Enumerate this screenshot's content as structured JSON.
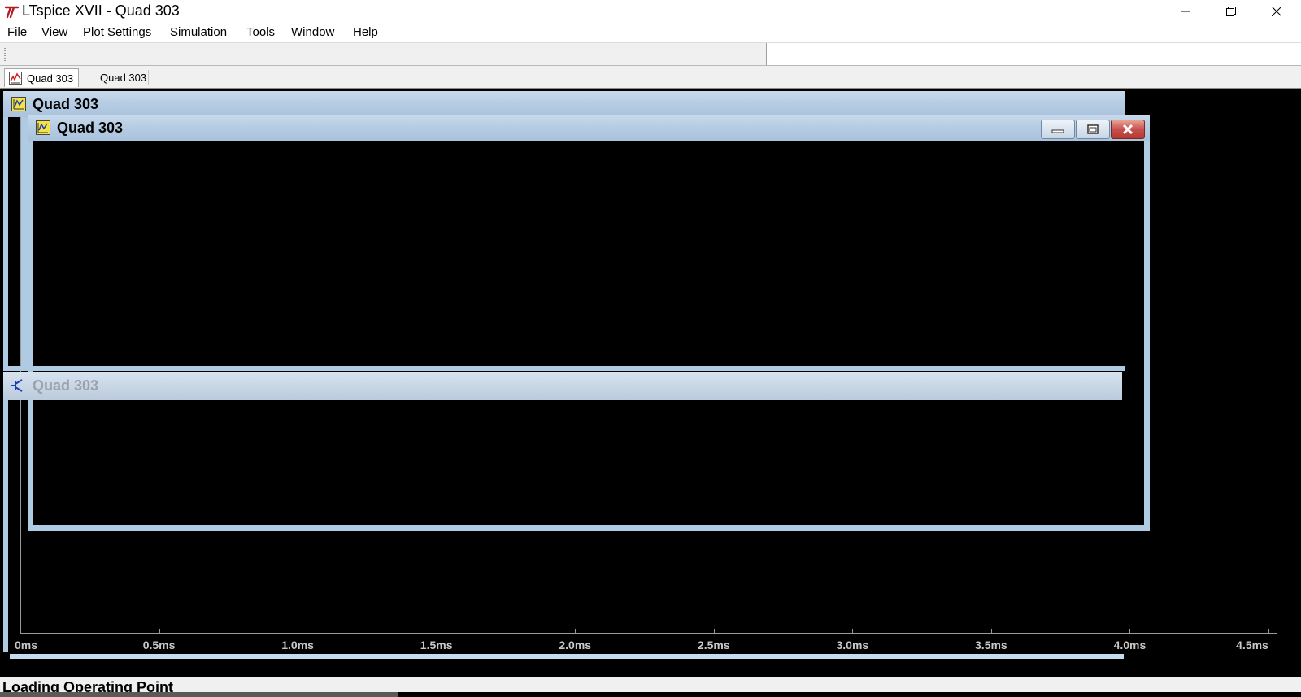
{
  "window": {
    "title": "LTspice XVII - Quad 303",
    "icon": "ltspice-logo-icon",
    "controls": [
      "minimize-icon",
      "restore-icon",
      "close-icon"
    ]
  },
  "menu": {
    "items": [
      {
        "ul": "F",
        "rest": "ile"
      },
      {
        "ul": "V",
        "rest": "iew"
      },
      {
        "ul": "P",
        "rest": "lot Settings"
      },
      {
        "ul": "S",
        "rest": "imulation"
      },
      {
        "ul": "T",
        "rest": "ools"
      },
      {
        "ul": "W",
        "rest": "indow"
      },
      {
        "ul": "H",
        "rest": "elp"
      }
    ]
  },
  "toolbar": {
    "field_value": ""
  },
  "tabs": [
    {
      "label": "Quad 303",
      "icon": "waveform-icon",
      "active": true
    },
    {
      "label": "Quad 303",
      "icon": "",
      "active": false
    }
  ],
  "child_windows": {
    "back_plot": {
      "title": "Quad 303",
      "icon": "plot-window-icon"
    },
    "front_plot": {
      "title": "Quad 303",
      "icon": "plot-window-icon"
    },
    "schematic": {
      "title": "Quad 303",
      "icon": "schematic-transistor-icon"
    }
  },
  "plot": {
    "x_ticks": [
      "0ms",
      "0.5ms",
      "1.0ms",
      "1.5ms",
      "2.0ms",
      "2.5ms",
      "3.0ms",
      "3.5ms",
      "4.0ms",
      "4.5ms"
    ]
  },
  "status": {
    "text": "Loading Operating Point"
  },
  "colors": {
    "plot_background": "#000000",
    "mdi_title_active": "#b7cde4",
    "mdi_border": "#aecbe3"
  }
}
